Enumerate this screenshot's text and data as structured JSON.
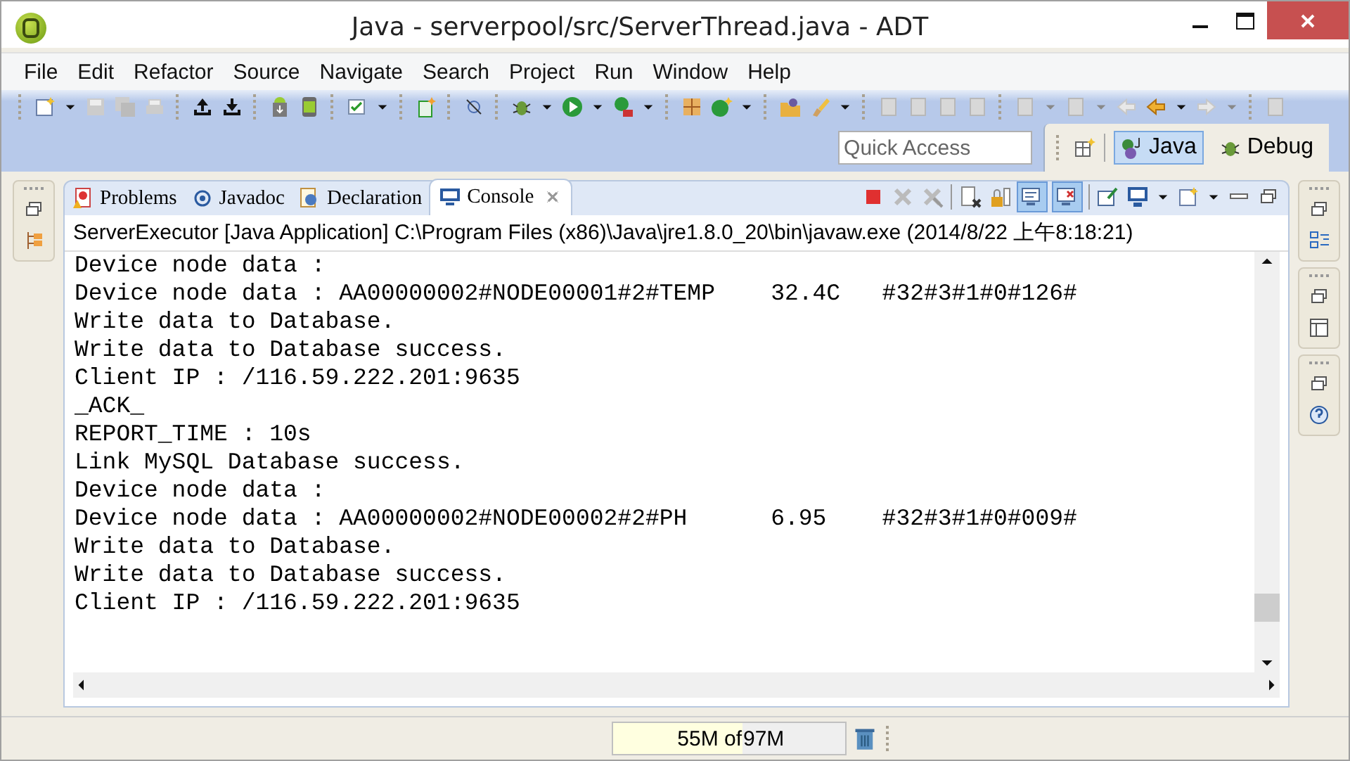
{
  "window": {
    "title": "Java - serverpool/src/ServerThread.java - ADT"
  },
  "menu": [
    "File",
    "Edit",
    "Refactor",
    "Source",
    "Navigate",
    "Search",
    "Project",
    "Run",
    "Window",
    "Help"
  ],
  "quick_access": {
    "placeholder": "Quick Access"
  },
  "perspectives": [
    {
      "label": "Java",
      "selected": true
    },
    {
      "label": "Debug",
      "selected": false
    }
  ],
  "console": {
    "tabs": [
      {
        "label": "Problems",
        "selected": false
      },
      {
        "label": "Javadoc",
        "selected": false
      },
      {
        "label": "Declaration",
        "selected": false
      },
      {
        "label": "Console",
        "selected": true
      }
    ],
    "process": "ServerExecutor [Java Application] C:\\Program Files (x86)\\Java\\jre1.8.0_20\\bin\\javaw.exe (2014/8/22 上午8:18:21)",
    "lines": [
      "Device node data :",
      "Device node data : AA00000002#NODE00001#2#TEMP    32.4C   #32#3#1#0#126#",
      "Write data to Database.",
      "Write data to Database success.",
      "Client IP : /116.59.222.201:9635",
      "_ACK_",
      "REPORT_TIME : 10s",
      "Link MySQL Database success.",
      "Device node data :",
      "Device node data : AA00000002#NODE00002#2#PH      6.95    #32#3#1#0#009#",
      "Write data to Database.",
      "Write data to Database success.",
      "Client IP : /116.59.222.201:9635"
    ]
  },
  "status_bar": {
    "heap_used": "55M of",
    "heap_total": "97M",
    "level": 0.56
  }
}
